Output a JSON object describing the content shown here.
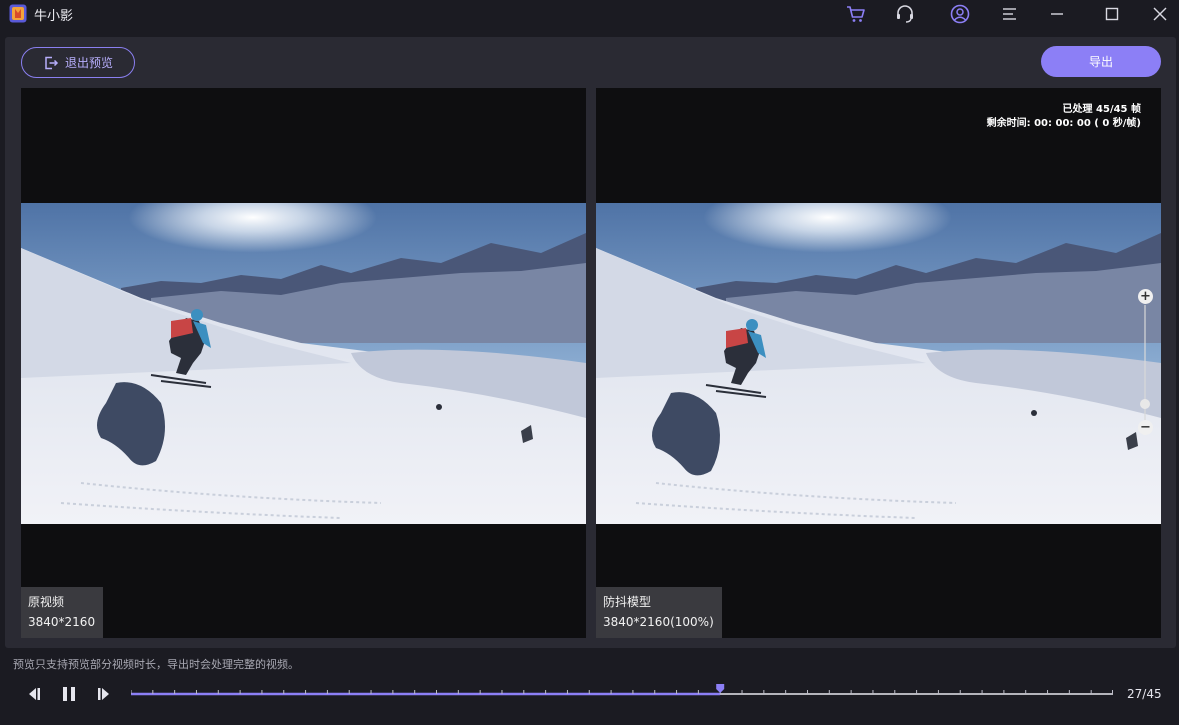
{
  "app": {
    "title": "牛小影"
  },
  "titlebar_icons": [
    "cart-icon",
    "headset-icon",
    "user-icon",
    "menu-icon",
    "minimize-icon",
    "maximize-icon",
    "close-icon"
  ],
  "toolbar": {
    "exit_label": "退出预览",
    "export_label": "导出"
  },
  "left_pane": {
    "name": "原视频",
    "resolution": "3840*2160"
  },
  "right_pane": {
    "name": "防抖模型",
    "resolution": "3840*2160(100%)",
    "processed": "已处理 45/45 帧",
    "remaining": "剩余时间: 00: 00: 00 ( 0 秒/帧)"
  },
  "zoom": {
    "plus": "+",
    "minus": "−",
    "level": 0.07
  },
  "footer": {
    "notice": "预览只支持预览部分视频时长，导出时会处理完整的视频。",
    "current_frame": 27,
    "total_frames": 45,
    "counter": "27/45"
  },
  "colors": {
    "accent": "#8c7ff6",
    "accent_light": "#b7aefc",
    "background": "#1b1b22",
    "panel": "#2a2a33",
    "video_bg": "#0e0e10"
  }
}
